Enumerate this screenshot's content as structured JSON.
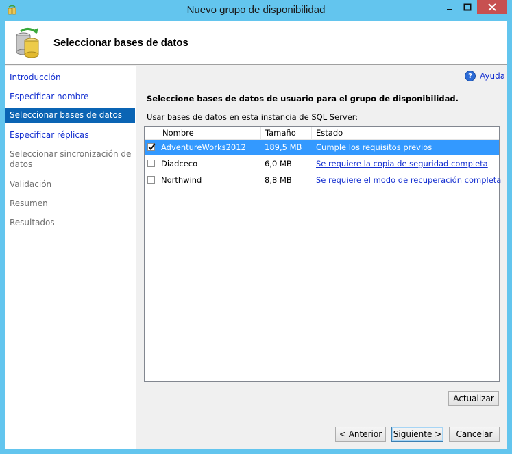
{
  "window": {
    "title": "Nuevo grupo de disponibilidad"
  },
  "header": {
    "title": "Seleccionar bases de datos"
  },
  "sidebar": {
    "items": [
      {
        "label": "Introducción",
        "state": "link"
      },
      {
        "label": "Especificar nombre",
        "state": "link"
      },
      {
        "label": "Seleccionar bases de datos",
        "state": "active"
      },
      {
        "label": "Especificar réplicas",
        "state": "link"
      },
      {
        "label": "Seleccionar sincronización de",
        "label2": "datos",
        "state": "disabled"
      },
      {
        "label": "Validación",
        "state": "disabled"
      },
      {
        "label": "Resumen",
        "state": "disabled"
      },
      {
        "label": "Resultados",
        "state": "disabled"
      }
    ]
  },
  "help": {
    "label": "Ayuda"
  },
  "main": {
    "instruction": "Seleccione bases de datos de usuario para el grupo de disponibilidad.",
    "list_label": "Usar bases de datos en esta instancia de SQL Server:",
    "columns": [
      "Nombre",
      "Tamaño",
      "Estado"
    ],
    "rows": [
      {
        "checked": true,
        "name": "AdventureWorks2012",
        "size": "189,5 MB",
        "status": "Cumple los requisitos previos",
        "selected": true
      },
      {
        "checked": false,
        "name": "Diadceco",
        "size": "6,0 MB",
        "status": "Se requiere la copia de seguridad completa",
        "selected": false
      },
      {
        "checked": false,
        "name": "Northwind",
        "size": "8,8 MB",
        "status": "Se requiere el modo de recuperación completa",
        "selected": false
      }
    ]
  },
  "buttons": {
    "refresh": "Actualizar",
    "back": "< Anterior",
    "next": "Siguiente >",
    "cancel": "Cancelar"
  },
  "colors": {
    "frame": "#63C5EE",
    "close": "#C75050",
    "selection": "#3399FF",
    "nav_active": "#0A64B4",
    "link": "#1530D0"
  }
}
